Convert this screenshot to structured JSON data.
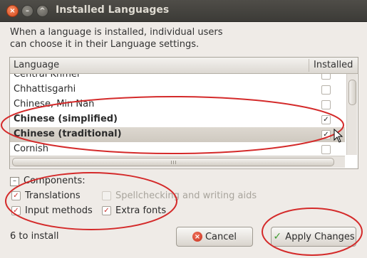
{
  "window": {
    "title": "Installed Languages",
    "controls": {
      "close": "×",
      "minimize": "–",
      "maximize": "^"
    }
  },
  "intro": {
    "line1": "When a language is installed, individual users",
    "line2": "can choose it in their Language settings."
  },
  "table": {
    "headers": {
      "language": "Language",
      "installed": "Installed"
    },
    "rows": [
      {
        "label": "Central Khmer",
        "installed": false,
        "partial": true
      },
      {
        "label": "Chhattisgarhi",
        "installed": false
      },
      {
        "label": "Chinese, Min Nan",
        "installed": false
      },
      {
        "label": "Chinese (simplified)",
        "installed": true,
        "bold": true
      },
      {
        "label": "Chinese (traditional)",
        "installed": true,
        "bold": true,
        "selected": true
      },
      {
        "label": "Cornish",
        "installed": false
      }
    ]
  },
  "components": {
    "label": "Components:",
    "expander": "–",
    "options": [
      {
        "key": "translations",
        "label": "Translations",
        "checked": true,
        "enabled": true
      },
      {
        "key": "spellchecking",
        "label": "Spellchecking and writing aids",
        "checked": false,
        "enabled": false
      },
      {
        "key": "input_methods",
        "label": "Input methods",
        "checked": true,
        "enabled": true
      },
      {
        "key": "extra_fonts",
        "label": "Extra fonts",
        "checked": true,
        "enabled": true
      }
    ]
  },
  "status": {
    "install_count": "6 to install"
  },
  "buttons": {
    "cancel": {
      "label": "Cancel",
      "icon": "cancel-icon"
    },
    "apply": {
      "label": "Apply Changes",
      "icon": "checkmark-icon"
    }
  },
  "colors": {
    "annotation": "#d42a2a",
    "titlebar": "#3c3b37",
    "selection": "#d6d0c8"
  }
}
